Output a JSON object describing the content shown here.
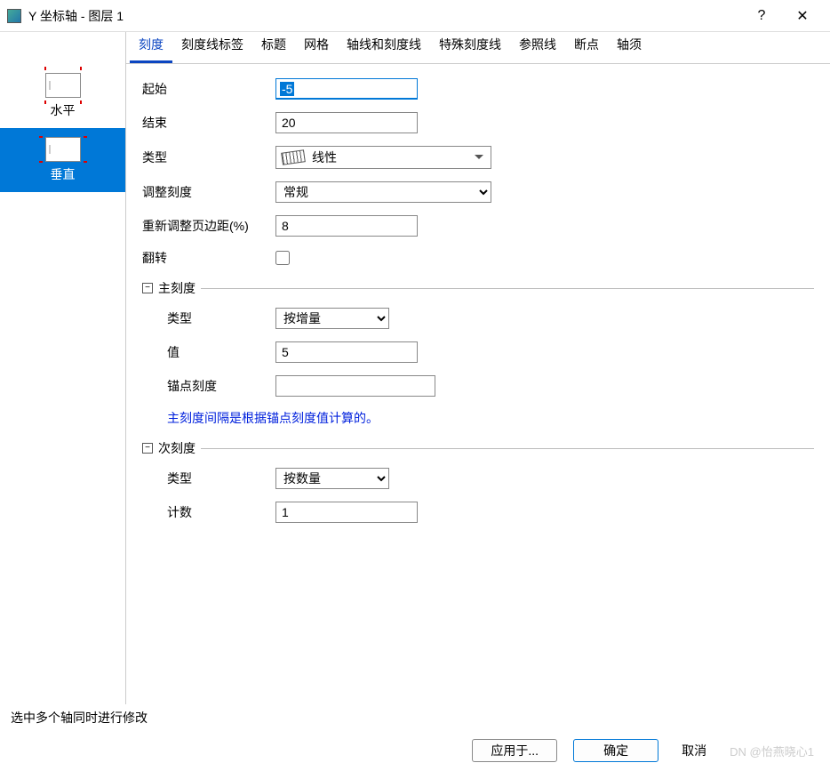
{
  "window": {
    "title": "Y 坐标轴 - 图层 1"
  },
  "sidebar": {
    "items": [
      {
        "label": "水平"
      },
      {
        "label": "垂直"
      }
    ]
  },
  "tabs": [
    {
      "label": "刻度"
    },
    {
      "label": "刻度线标签"
    },
    {
      "label": "标题"
    },
    {
      "label": "网格"
    },
    {
      "label": "轴线和刻度线"
    },
    {
      "label": "特殊刻度线"
    },
    {
      "label": "参照线"
    },
    {
      "label": "断点"
    },
    {
      "label": "轴须"
    }
  ],
  "form": {
    "start_label": "起始",
    "start_value": "-5",
    "end_label": "结束",
    "end_value": "20",
    "type_label": "类型",
    "type_value": "线性",
    "adjust_label": "调整刻度",
    "adjust_value": "常规",
    "margin_label": "重新调整页边距(%)",
    "margin_value": "8",
    "flip_label": "翻转"
  },
  "major": {
    "title": "主刻度",
    "type_label": "类型",
    "type_value": "按增量",
    "value_label": "值",
    "value_value": "5",
    "anchor_label": "锚点刻度",
    "anchor_value": "",
    "hint": "主刻度间隔是根据锚点刻度值计算的。"
  },
  "minor": {
    "title": "次刻度",
    "type_label": "类型",
    "type_value": "按数量",
    "count_label": "计数",
    "count_value": "1"
  },
  "footer": {
    "hint": "选中多个轴同时进行修改",
    "apply": "应用于...",
    "ok": "确定",
    "cancel": "取消",
    "watermark": "DN @怡燕晓心1"
  }
}
